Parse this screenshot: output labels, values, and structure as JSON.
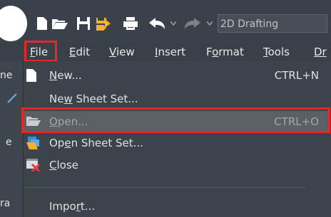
{
  "quick_access": {
    "icons": [
      "new-icon",
      "open-folder-icon",
      "save-icon",
      "save-as-icon",
      "print-icon",
      "undo-icon",
      "redo-icon"
    ],
    "workspace": "2D Drafting"
  },
  "menubar": {
    "items": [
      {
        "prefix": "",
        "hot": "F",
        "rest": "ile"
      },
      {
        "prefix": "",
        "hot": "E",
        "rest": "dit"
      },
      {
        "prefix": "",
        "hot": "V",
        "rest": "iew"
      },
      {
        "prefix": "",
        "hot": "I",
        "rest": "nsert"
      },
      {
        "prefix": "F",
        "hot": "o",
        "rest": "rmat"
      },
      {
        "prefix": "",
        "hot": "T",
        "rest": "ools"
      },
      {
        "prefix": "",
        "hot": "Dr",
        "rest": ""
      }
    ]
  },
  "left_strip": {
    "texts": [
      "ne",
      "e",
      "ra"
    ]
  },
  "file_menu": {
    "items": [
      {
        "pre": "",
        "hot": "N",
        "post": "ew...",
        "shortcut": "CTRL+N",
        "icon": "new-document-icon"
      },
      {
        "pre": "Ne",
        "hot": "w",
        "post": " Sheet Set...",
        "shortcut": "",
        "icon": ""
      },
      {
        "pre": "",
        "hot": "O",
        "post": "pen...",
        "shortcut": "CTRL+O",
        "icon": "open-folder-icon"
      },
      {
        "pre": "Op",
        "hot": "e",
        "post": "n Sheet Set...",
        "shortcut": "",
        "icon": "open-sheet-set-icon"
      },
      {
        "pre": "",
        "hot": "C",
        "post": "lose",
        "shortcut": "",
        "icon": "close-document-icon"
      },
      {
        "pre": "Impo",
        "hot": "r",
        "post": "t...",
        "shortcut": "",
        "icon": ""
      }
    ]
  },
  "colors": {
    "highlight": "#e02a2a",
    "menu_bg": "#3d434a",
    "active_bg": "#5b6066"
  }
}
